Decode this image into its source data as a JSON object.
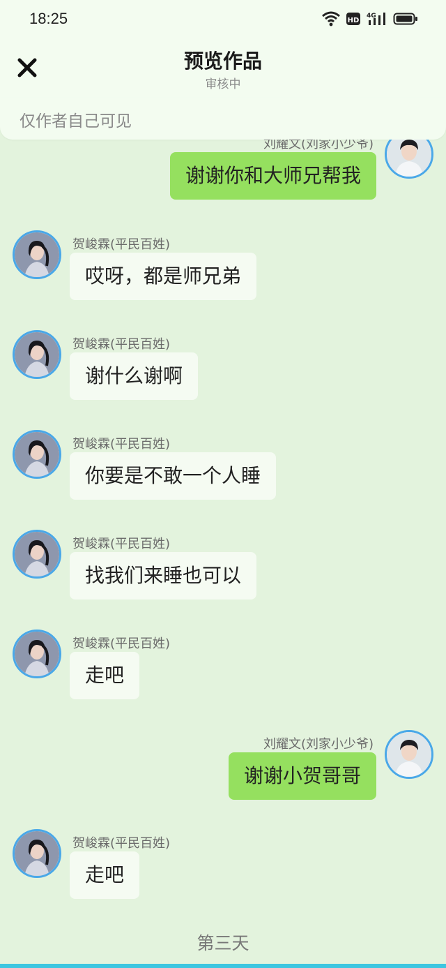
{
  "status_bar": {
    "time": "18:25",
    "icons": [
      "wifi-icon",
      "hd-icon",
      "signal-4g-icon",
      "battery-icon"
    ],
    "hd_label": "HD",
    "net_label": "4G"
  },
  "header": {
    "title": "预览作品",
    "subtitle": "审核中",
    "close_icon": "close-icon"
  },
  "visibility_notice": "仅作者自己可见",
  "messages": [
    {
      "side": "right",
      "sender": "刘耀文(刘家小少爷)",
      "text": "谢谢你和大师兄帮我"
    },
    {
      "side": "left",
      "sender": "贺峻霖(平民百姓)",
      "text": "哎呀，都是师兄弟"
    },
    {
      "side": "left",
      "sender": "贺峻霖(平民百姓)",
      "text": "谢什么谢啊"
    },
    {
      "side": "left",
      "sender": "贺峻霖(平民百姓)",
      "text": "你要是不敢一个人睡"
    },
    {
      "side": "left",
      "sender": "贺峻霖(平民百姓)",
      "text": "找我们来睡也可以"
    },
    {
      "side": "left",
      "sender": "贺峻霖(平民百姓)",
      "text": "走吧"
    },
    {
      "side": "right",
      "sender": "刘耀文(刘家小少爷)",
      "text": "谢谢小贺哥哥"
    },
    {
      "side": "left",
      "sender": "贺峻霖(平民百姓)",
      "text": "走吧"
    }
  ],
  "day_label": "第三天",
  "colors": {
    "background": "#e3f3dd",
    "right_bubble": "#95e05f",
    "left_bubble": "#f5fbf2",
    "avatar_border": "#4aa8e8",
    "bottom_accent": "#3dc6e0"
  }
}
